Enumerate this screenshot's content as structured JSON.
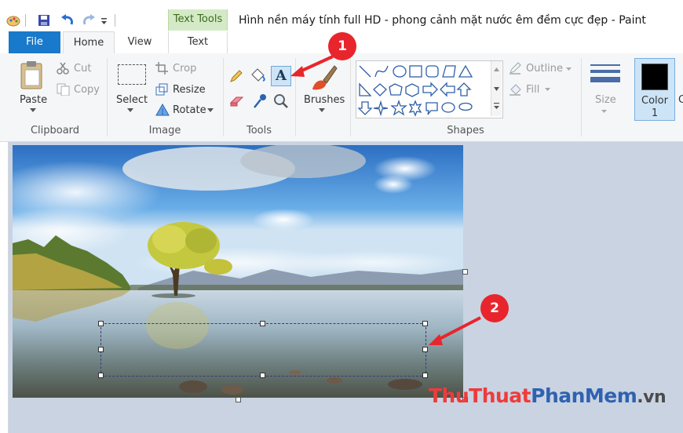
{
  "window": {
    "title": "Hình nền máy tính full HD - phong cảnh mặt nước êm đềm cực đẹp - Paint",
    "context_tab_group": "Text Tools"
  },
  "tabs": [
    {
      "label": "File"
    },
    {
      "label": "Home"
    },
    {
      "label": "View"
    },
    {
      "label": "Text"
    }
  ],
  "clipboard": {
    "paste": "Paste",
    "cut": "Cut",
    "copy": "Copy",
    "group": "Clipboard"
  },
  "image_group": {
    "select": "Select",
    "crop": "Crop",
    "resize": "Resize",
    "rotate": "Rotate",
    "group": "Image"
  },
  "tools_group": {
    "group": "Tools",
    "text_tool_glyph": "A"
  },
  "brushes": {
    "label": "Brushes"
  },
  "shapes_group": {
    "outline": "Outline",
    "fill": "Fill",
    "group": "Shapes"
  },
  "size": {
    "label": "Size"
  },
  "color1": {
    "label": "Color",
    "index": "1",
    "swatch": "#000000"
  },
  "annotations": {
    "badge1": "1",
    "badge2": "2",
    "accent": "#e8252c"
  },
  "watermark": {
    "part1": "ThuThuat",
    "part2": "PhanMem",
    "part3": ".vn"
  }
}
